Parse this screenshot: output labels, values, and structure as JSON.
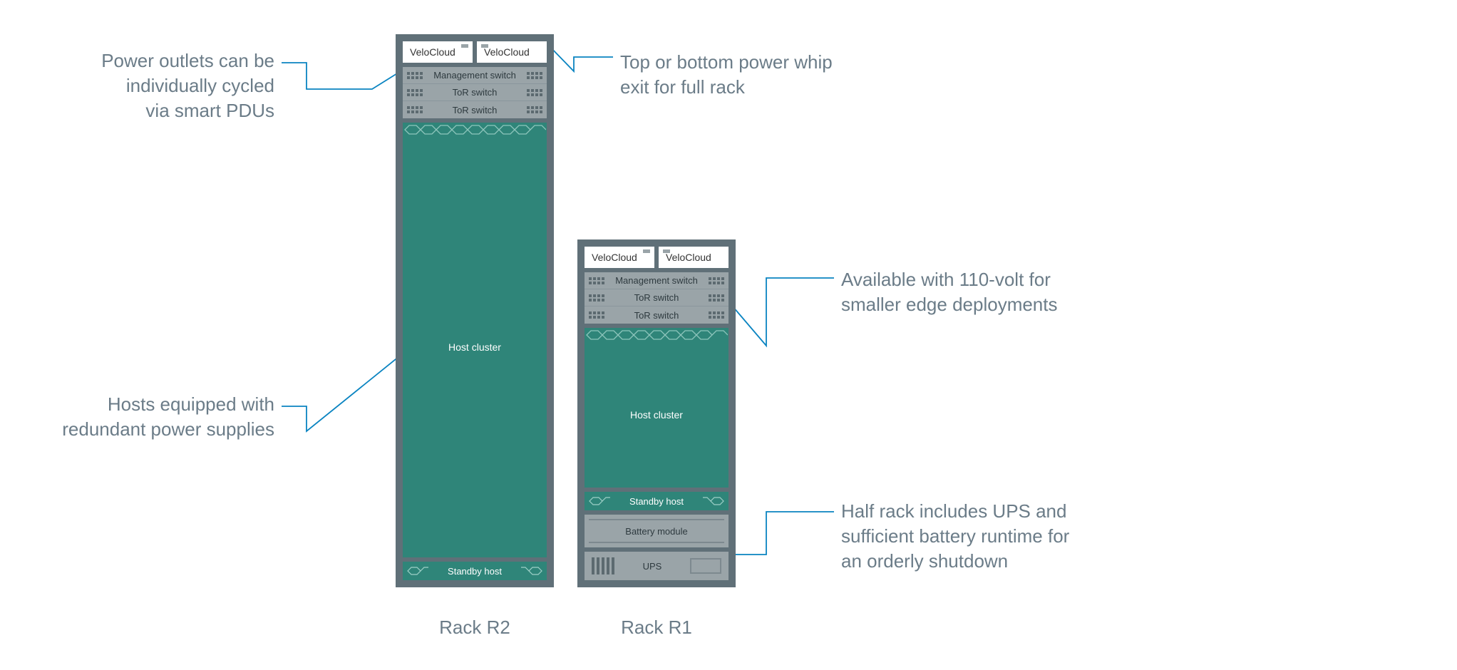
{
  "callouts": {
    "pdu": "Power outlets can be\nindividually cycled\nvia smart PDUs",
    "whip": "Top or bottom power whip\nexit for full rack",
    "hosts": "Hosts equipped with\nredundant power supplies",
    "volt": "Available with 110-volt for\nsmaller edge deployments",
    "ups": "Half rack includes UPS and\nsufficient battery runtime for\nan orderly shutdown"
  },
  "rackR2": {
    "caption": "Rack R2",
    "velocloud1": "VeloCloud",
    "velocloud2": "VeloCloud",
    "mgmt": "Management switch",
    "tor1": "ToR switch",
    "tor2": "ToR switch",
    "cluster": "Host cluster",
    "standby": "Standby host"
  },
  "rackR1": {
    "caption": "Rack R1",
    "velocloud1": "VeloCloud",
    "velocloud2": "VeloCloud",
    "mgmt": "Management switch",
    "tor1": "ToR switch",
    "tor2": "ToR switch",
    "cluster": "Host cluster",
    "standby": "Standby host",
    "battery": "Battery module",
    "ups": "UPS"
  }
}
